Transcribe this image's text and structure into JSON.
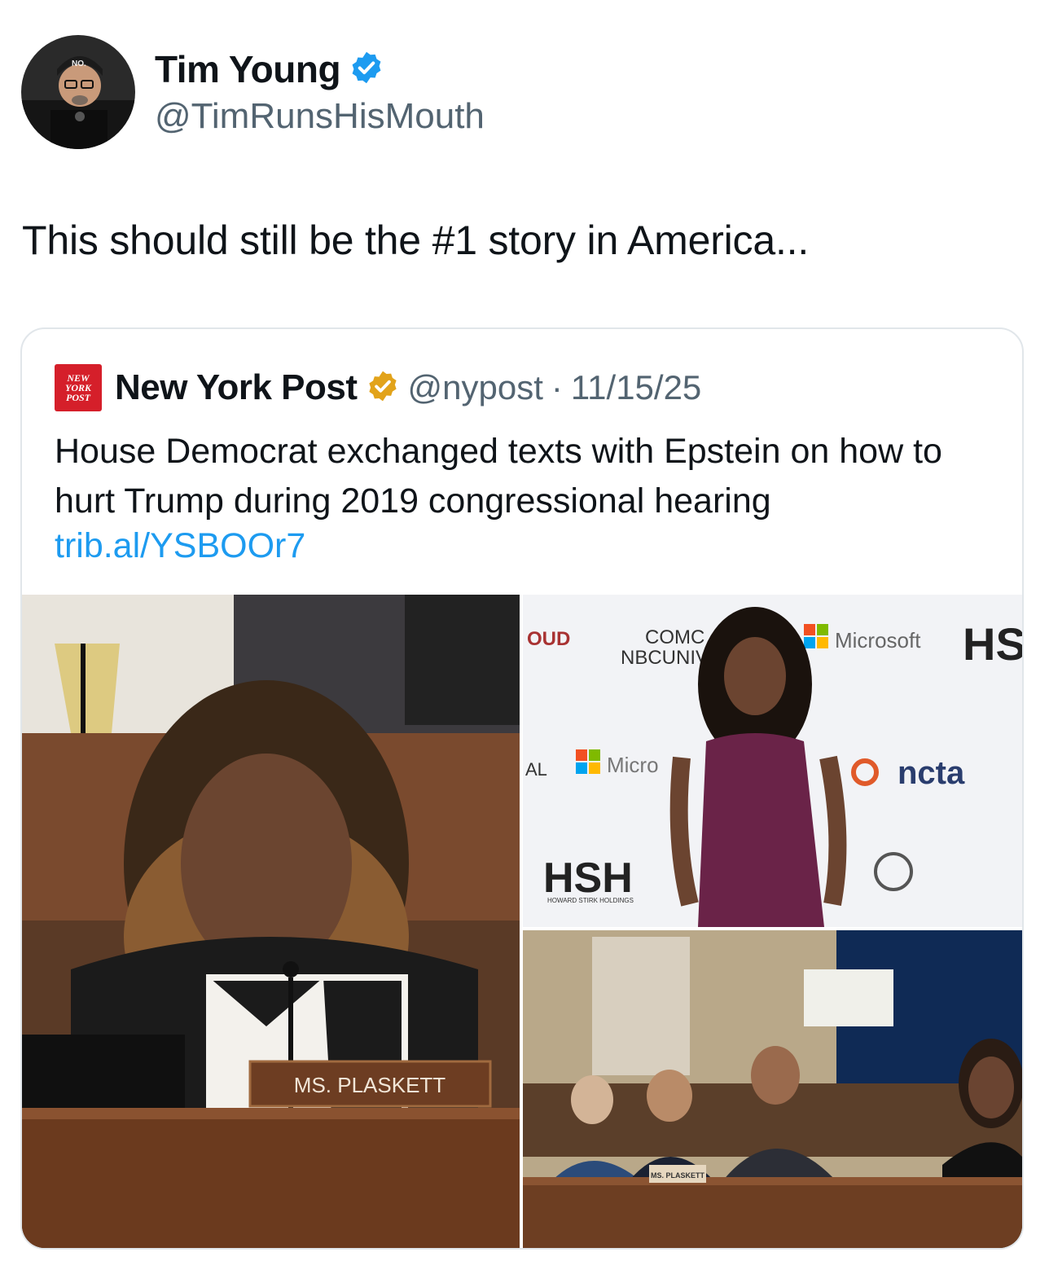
{
  "author": {
    "display_name": "Tim Young",
    "handle": "@TimRunsHisMouth",
    "verified_color": "#1d9bf0",
    "avatar_cap_text": "NO."
  },
  "tweet": {
    "text": "This should still be the #1 story in America..."
  },
  "quoted_tweet": {
    "logo_lines": [
      "NEW",
      "YORK",
      "POST"
    ],
    "display_name": "New York Post",
    "verified_color": "#e2a31a",
    "handle": "@nypost",
    "separator": "·",
    "date": "11/15/25",
    "text": "House Democrat exchanged texts with Epstein on how to hurt Trump during 2019 congressional hearing",
    "link": "trib.al/YSBOOr7",
    "link_color": "#1d9bf0"
  },
  "media": {
    "photo1": {
      "nameplate": "MS. PLASKETT"
    },
    "photo2": {
      "backdrop_texts": [
        "Microsoft",
        "Micro",
        "COMC",
        "NBCUNIV",
        "ncta",
        "HSH",
        "HOWARD STIRK HOLDINGS",
        "HS",
        "OUD",
        "AL"
      ]
    },
    "photo3": {
      "nameplates": [
        "MS. PLASKETT"
      ]
    }
  }
}
